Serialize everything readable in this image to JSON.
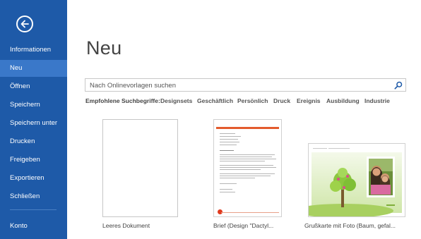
{
  "sidebar": {
    "back_label": "Zurück",
    "items": [
      {
        "label": "Informationen",
        "active": false
      },
      {
        "label": "Neu",
        "active": true
      },
      {
        "label": "Öffnen",
        "active": false
      },
      {
        "label": "Speichern",
        "active": false
      },
      {
        "label": "Speichern unter",
        "active": false
      },
      {
        "label": "Drucken",
        "active": false
      },
      {
        "label": "Freigeben",
        "active": false
      },
      {
        "label": "Exportieren",
        "active": false
      },
      {
        "label": "Schließen",
        "active": false
      },
      {
        "label": "Konto",
        "active": false
      }
    ]
  },
  "main": {
    "title": "Neu",
    "search": {
      "placeholder": "Nach Onlinevorlagen suchen",
      "value": "",
      "icon": "search-icon"
    },
    "suggestions": {
      "label": "Empfohlene Suchbegriffe:",
      "items": [
        "Designsets",
        "Geschäftlich",
        "Persönlich",
        "Druck",
        "Ereignis",
        "Ausbildung",
        "Industrie"
      ]
    },
    "templates": [
      {
        "label": "Leeres Dokument"
      },
      {
        "label": "Brief (Design \"Dactyl..."
      },
      {
        "label": "Grußkarte mit Foto (Baum, gefal..."
      }
    ]
  },
  "colors": {
    "sidebar_bg": "#1e5aa8",
    "sidebar_active": "#3a78c9",
    "accent_orange": "#e35b2d",
    "card_green": "#8cc63f"
  }
}
